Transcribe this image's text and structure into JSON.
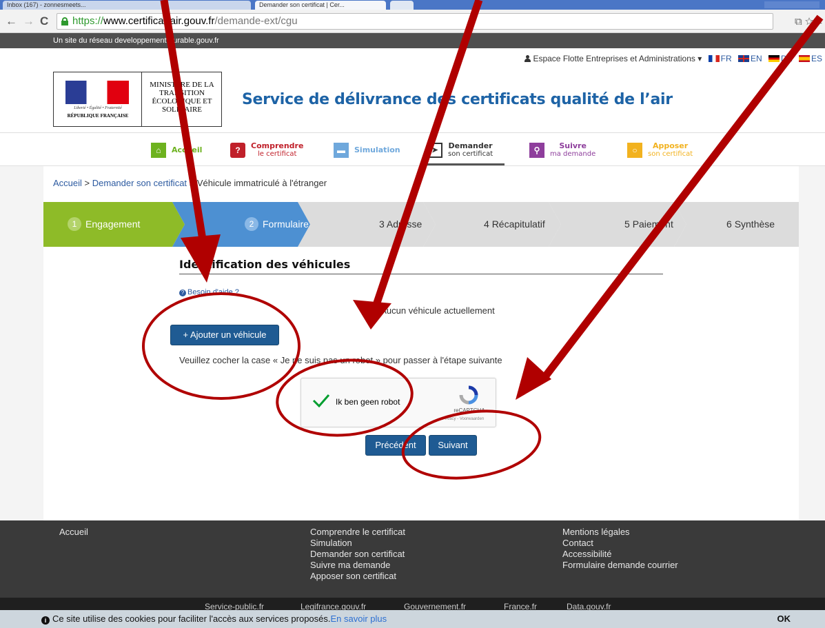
{
  "browser": {
    "tabs": [
      "Inbox (167) - zonnesmeets...",
      "Demander son certificat | Cer..."
    ],
    "url_scheme": "https://",
    "url_host": "www.certificat-air.gouv.fr",
    "url_path": "/demande-ext/cgu"
  },
  "govbar": {
    "text": "Un site du réseau developpement-durable.gouv.fr"
  },
  "header": {
    "fleet_link": "Espace Flotte Entreprises et Administrations ▾",
    "languages": [
      "FR",
      "EN",
      "DE",
      "ES"
    ],
    "marianne_motto": "Liberté • Égalité • Fraternité",
    "marianne_rep": "RÉPUBLIQUE FRANÇAISE",
    "ministry": "Ministère de la Transition Écologique et Solidaire",
    "site_title": "Service de délivrance des certificats qualité de l’air"
  },
  "menu": {
    "accueil": "Accueil",
    "comprendre": "Comprendre",
    "comprendre_sub": "le certificat",
    "simulation": "Simulation",
    "demander": "Demander",
    "demander_sub": "son certificat",
    "suivre": "Suivre",
    "suivre_sub": "ma demande",
    "apposer": "Apposer",
    "apposer_sub": "son certificat"
  },
  "breadcrumb": {
    "home": "Accueil",
    "sep1": " > ",
    "request": "Demander son certificat",
    "sep2": " > ",
    "current": "Véhicule immatriculé à l'étranger"
  },
  "steps": [
    {
      "num": "1",
      "label": "Engagement"
    },
    {
      "num": "2",
      "label": "Formulaire"
    },
    {
      "num": "3",
      "label": "Adresse"
    },
    {
      "num": "4",
      "label": "Récapitulatif"
    },
    {
      "num": "5",
      "label": "Paiement"
    },
    {
      "num": "6",
      "label": "Synthèse"
    }
  ],
  "form": {
    "section_title": "Identification des véhicules",
    "help_link": "Besoin d'aide ?",
    "no_vehicle": "Aucun véhicule actuellement",
    "add_vehicle": "+ Ajouter un véhicule",
    "captcha_note": "Veuillez cocher la case « Je ne suis pas un robot » pour passer à l'étape suivante",
    "recaptcha_label": "Ik ben geen robot",
    "recaptcha_brand": "reCAPTCHA",
    "recaptcha_links": "Privacy - Voorwaarden",
    "prev": "Précédent",
    "next": "Suivant"
  },
  "footer": {
    "col1": [
      "Accueil"
    ],
    "col2": [
      "Comprendre le certificat",
      "Simulation",
      "Demander son certificat",
      "Suivre ma demande",
      "Apposer son certificat"
    ],
    "col3": [
      "Mentions légales",
      "Contact",
      "Accessibilité",
      "Formulaire demande courrier"
    ],
    "sub": [
      "Service-public.fr",
      "Legifrance.gouv.fr",
      "Gouvernement.fr",
      "France.fr",
      "Data.gouv.fr"
    ]
  },
  "cookie": {
    "text": "Ce site utilise des cookies pour faciliter l'accès aux services proposés.",
    "more": "En savoir plus",
    "ok": "OK"
  },
  "annotation_color": "#b00000"
}
